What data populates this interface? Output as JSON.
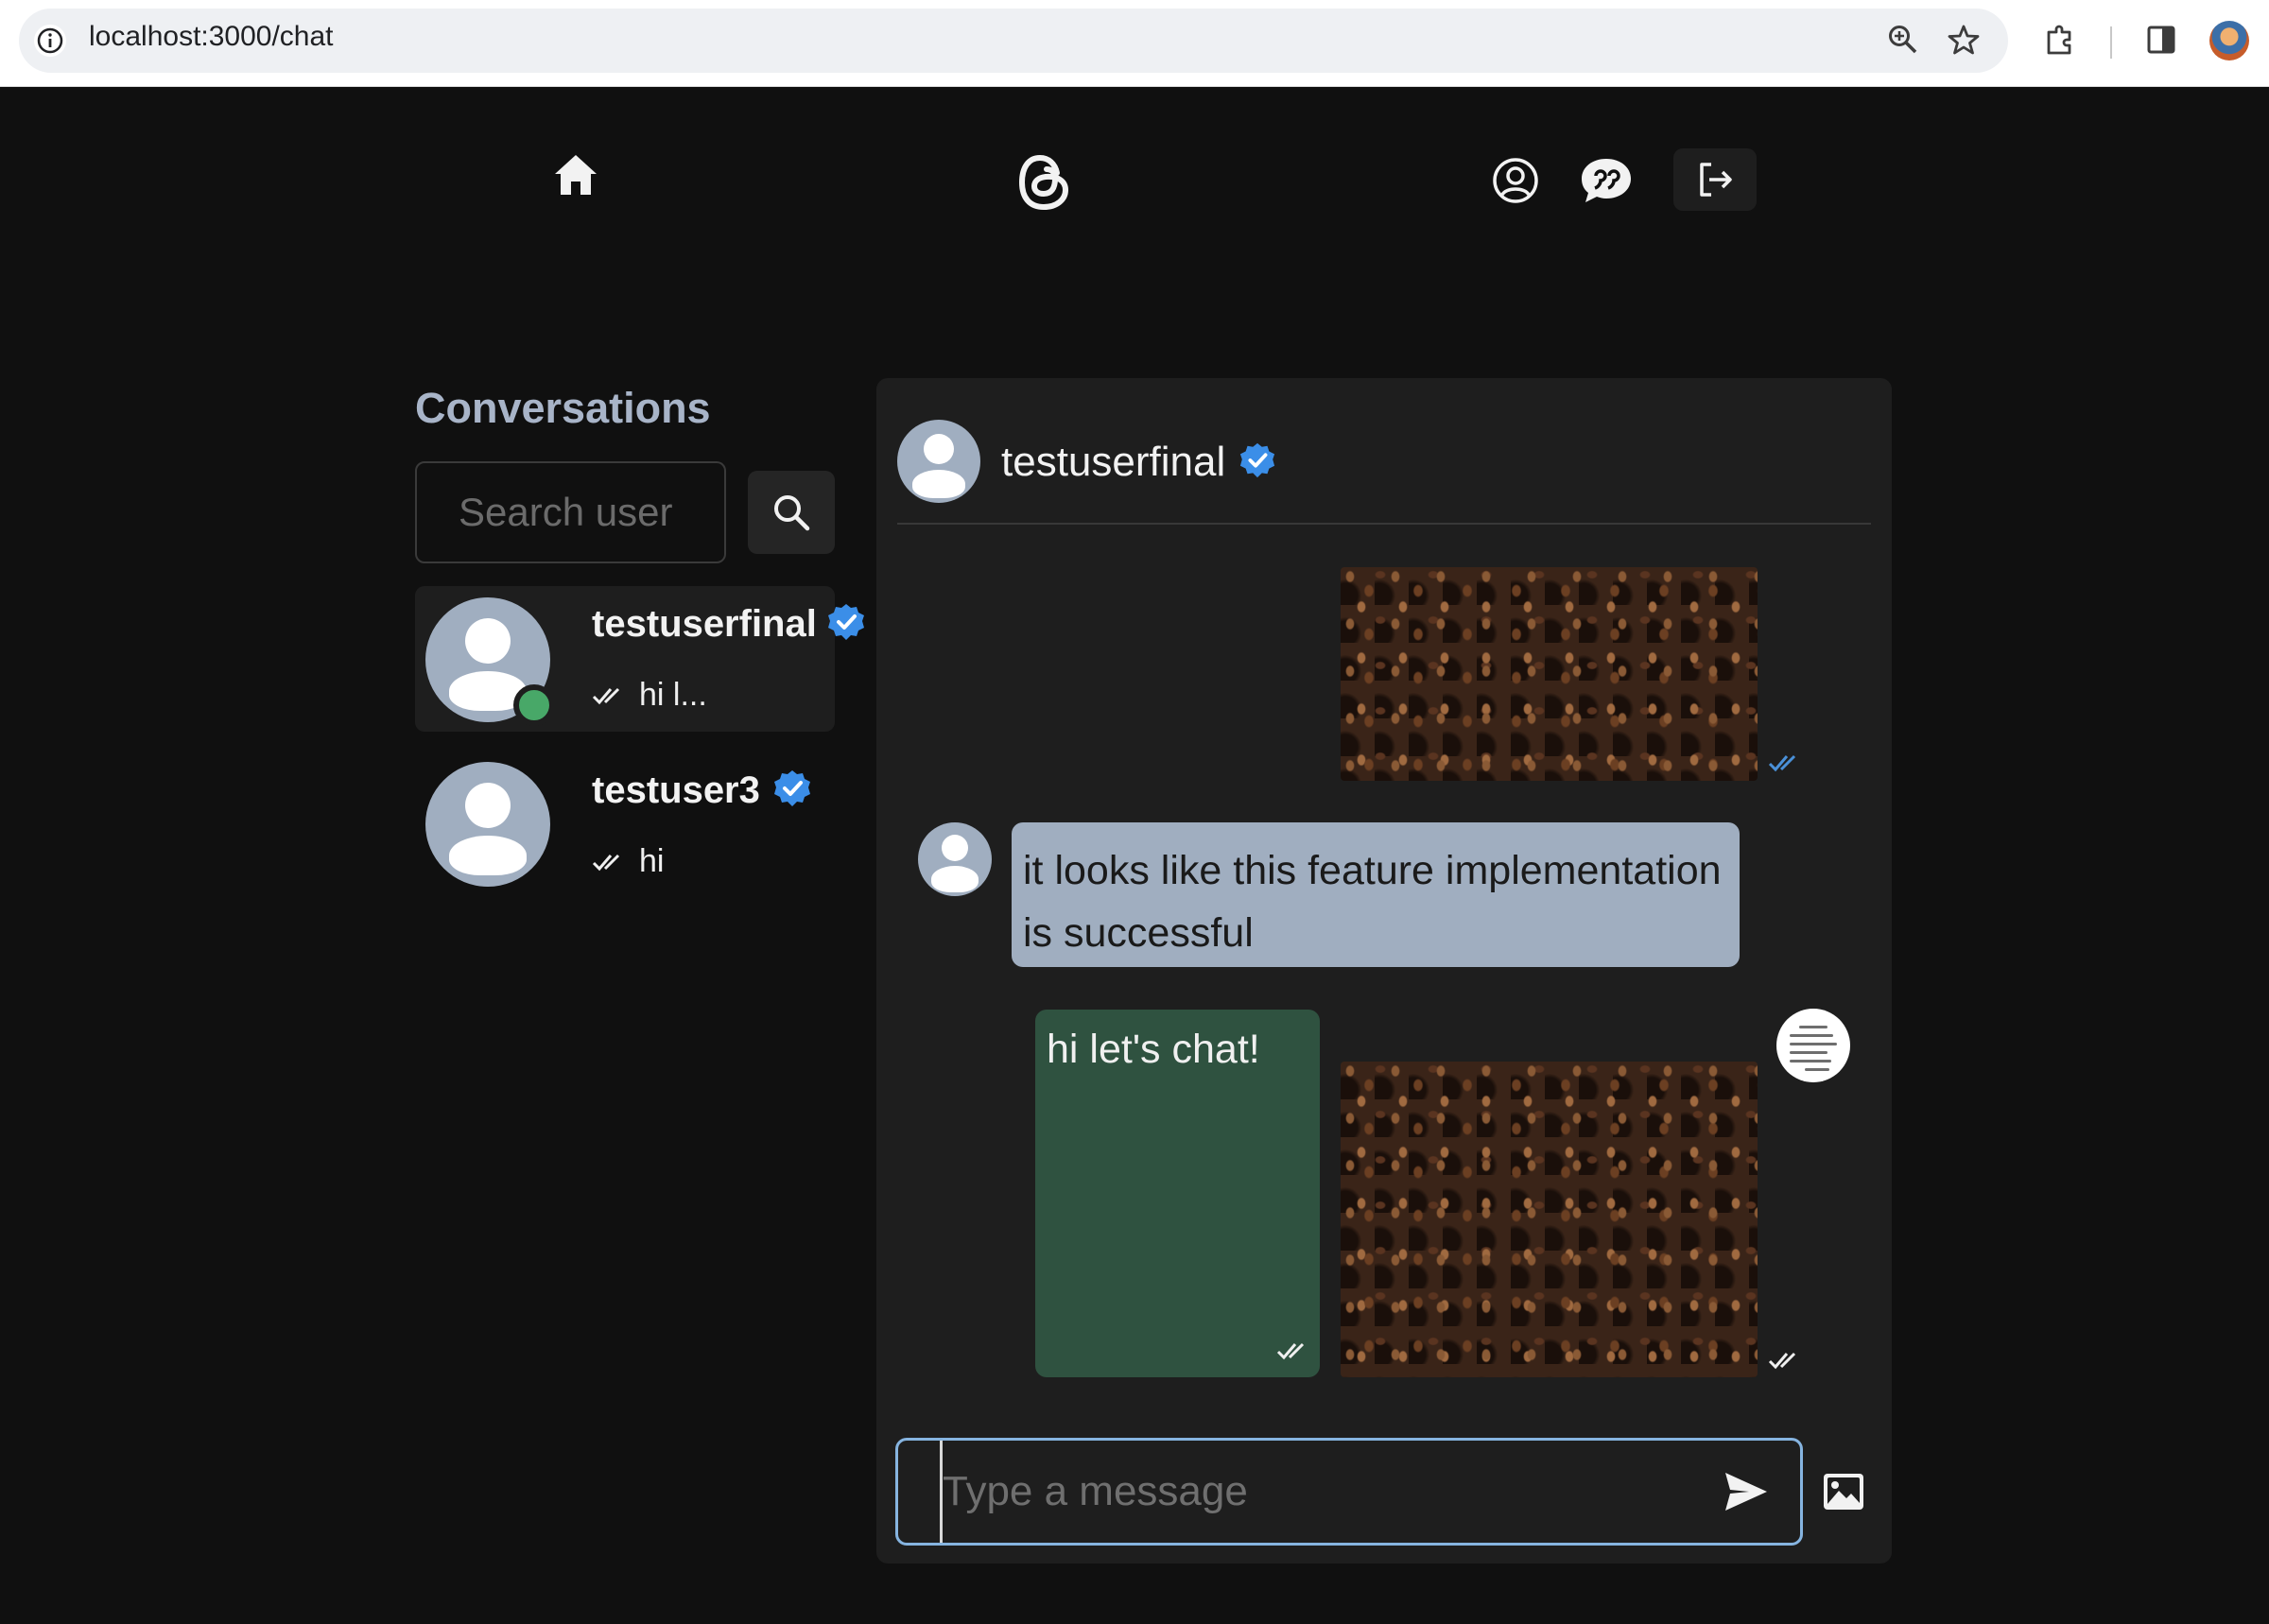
{
  "browser": {
    "url": "localhost:3000/chat"
  },
  "sidebar": {
    "title": "Conversations",
    "search_placeholder": "Search user",
    "conversations": [
      {
        "name": "testuserfinal",
        "last_message": "hi l...",
        "verified": true,
        "online": true,
        "active": true
      },
      {
        "name": "testuser3",
        "last_message": "hi",
        "verified": true,
        "online": false,
        "active": false
      }
    ]
  },
  "chat": {
    "recipient_name": "testuserfinal",
    "recipient_verified": true,
    "messages": [
      {
        "type": "image",
        "from": "me",
        "seen": true,
        "description": "coffee beans"
      },
      {
        "type": "text",
        "from": "them",
        "text": "it looks like this feature implementation is successful"
      },
      {
        "type": "text",
        "from": "me",
        "text": "hi let's chat!",
        "seen": false
      },
      {
        "type": "image",
        "from": "me",
        "seen": false,
        "description": "coffee beans"
      }
    ],
    "input_placeholder": "Type a message"
  },
  "colors": {
    "background": "#101010",
    "panel": "#1e1e1e",
    "accent_blue": "#3b8ee8",
    "online_green": "#48a868",
    "own_bubble": "#2f5240",
    "other_bubble": "#a0aec0",
    "seen_tick": "#4a90d8"
  },
  "icons": {
    "home": "home-icon",
    "logo": "threads-logo-icon",
    "profile": "user-circle-icon",
    "chat": "chat-bubble-icon",
    "logout": "logout-icon",
    "search": "search-icon",
    "send": "send-icon",
    "image": "image-icon"
  }
}
